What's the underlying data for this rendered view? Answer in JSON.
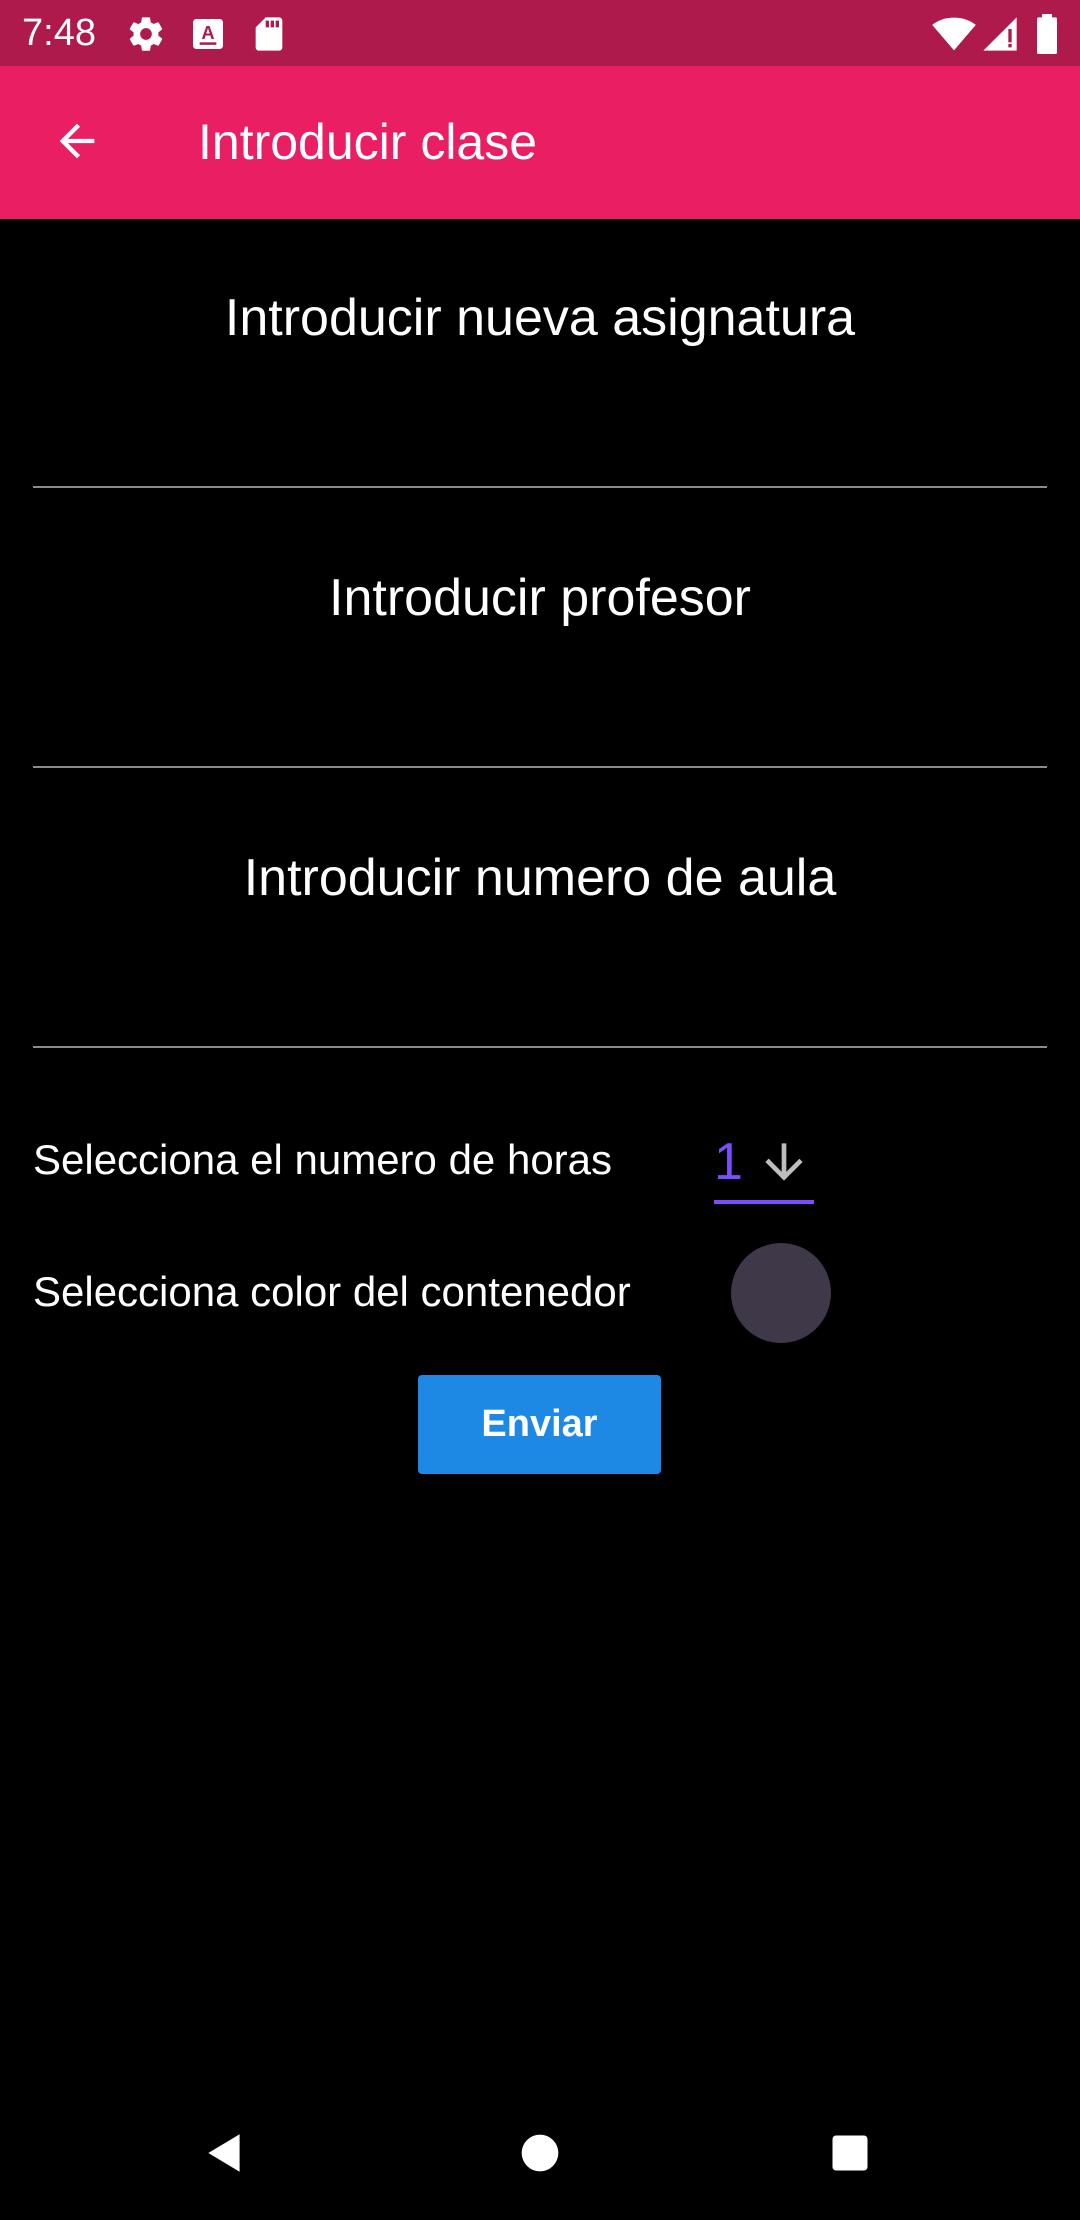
{
  "status_bar": {
    "time": "7:48",
    "icons": [
      "settings-icon",
      "keyboard-a-icon",
      "sd-card-icon",
      "wifi-icon",
      "signal-icon",
      "battery-icon"
    ]
  },
  "app_bar": {
    "title": "Introducir clase",
    "back_icon": "arrow-back-icon"
  },
  "form": {
    "subject": {
      "label": "Introducir nueva asignatura",
      "value": ""
    },
    "teacher": {
      "label": "Introducir profesor",
      "value": ""
    },
    "classroom": {
      "label": "Introducir numero de aula",
      "value": ""
    },
    "hours": {
      "label": "Selecciona el numero de horas",
      "selected": "1",
      "icon": "arrow-down-icon",
      "accent": "#7c4dff"
    },
    "container_color": {
      "label": "Selecciona color del contenedor",
      "color": "#3f3848"
    },
    "submit_label": "Enviar"
  },
  "nav_bar": {
    "icons": [
      "back-triangle-icon",
      "home-circle-icon",
      "recents-square-icon"
    ]
  },
  "colors": {
    "status_bar": "#ad1a4b",
    "app_bar": "#e91e63",
    "button": "#1e88e5",
    "background": "#000000"
  }
}
